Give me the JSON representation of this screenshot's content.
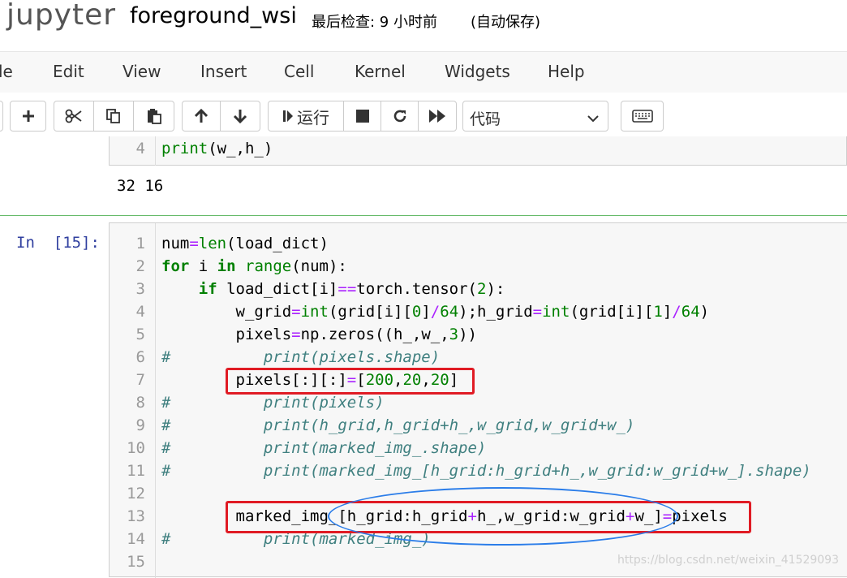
{
  "header": {
    "logo": "jupyter",
    "notebook_title": "foreground_wsi",
    "checkpoint": "最后检查: 9 小时前",
    "autosave": "(自动保存)"
  },
  "menubar": {
    "items": [
      "le",
      "Edit",
      "View",
      "Insert",
      "Cell",
      "Kernel",
      "Widgets",
      "Help"
    ]
  },
  "toolbar": {
    "run_label": "运行",
    "cell_type_value": "代码",
    "icons": [
      "plus-icon",
      "scissors-icon",
      "copy-icon",
      "paste-icon",
      "arrow-up-icon",
      "arrow-down-icon",
      "step-icon",
      "stop-icon",
      "restart-icon",
      "fast-forward-icon",
      "keyboard-icon"
    ]
  },
  "prev_cell": {
    "line_number": "4",
    "code": "print(w_,h_)",
    "output": "32 16"
  },
  "cell": {
    "prompt": "In  [15]:",
    "line_numbers": [
      "1",
      "2",
      "3",
      "4",
      "5",
      "6",
      "7",
      "8",
      "9",
      "10",
      "11",
      "12",
      "13",
      "14",
      "15"
    ],
    "lines": [
      "num=len(load_dict)",
      "for i in range(num):",
      "    if load_dict[i]==torch.tensor(2):",
      "        w_grid=int(grid[i][0]/64);h_grid=int(grid[i][1]/64)",
      "        pixels=np.zeros((h_,w_,3))",
      "#          print(pixels.shape)",
      "        pixels[:][:]=[200,20,20]",
      "#          print(pixels)",
      "#          print(h_grid,h_grid+h_,w_grid,w_grid+w_)",
      "#          print(marked_img_.shape)",
      "#          print(marked_img_[h_grid:h_grid+h_,w_grid:w_grid+w_].shape)",
      "",
      "        marked_img_[h_grid:h_grid+h_,w_grid:w_grid+w_]=pixels",
      "#          print(marked_img_)",
      ""
    ]
  },
  "watermark": "https://blog.csdn.net/weixin_41529093",
  "colors": {
    "keyword": "#008000",
    "operator": "#aa22ff",
    "comment": "#408080",
    "prompt": "#303f9f",
    "annotation_red": "#e01b24",
    "annotation_blue": "#2b7de9"
  }
}
